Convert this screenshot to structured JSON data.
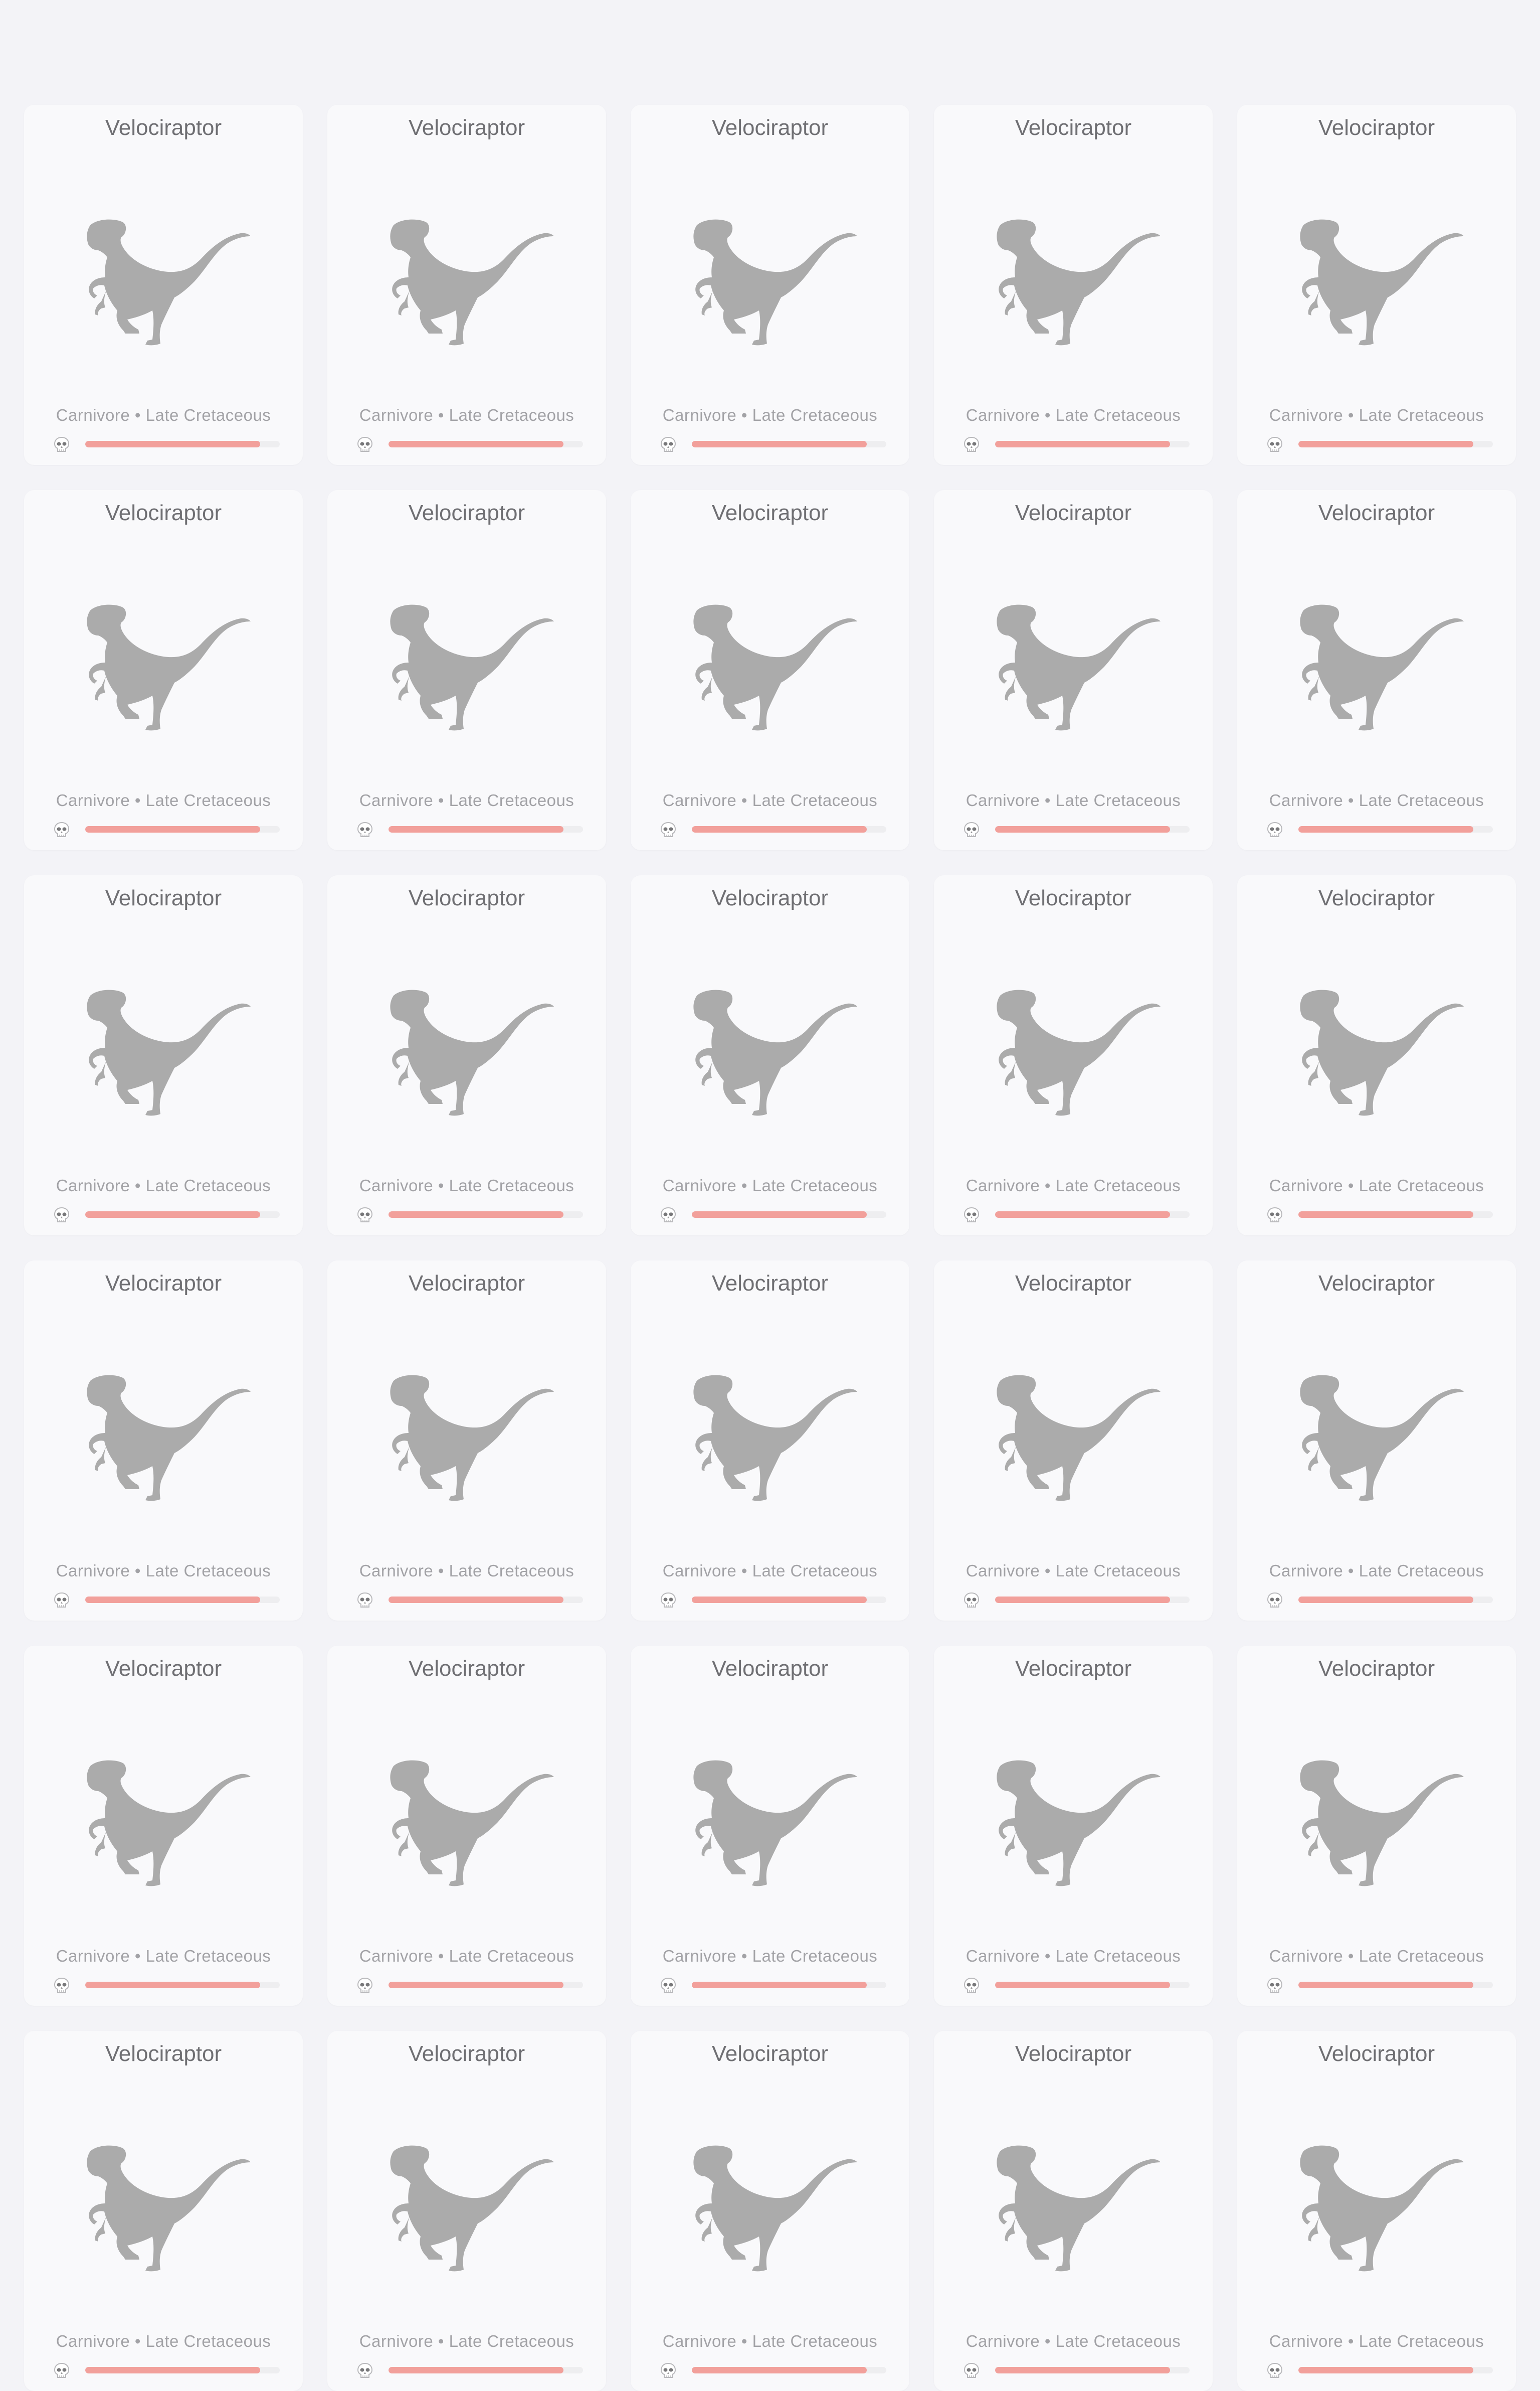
{
  "cards": [
    {
      "name": "Velociraptor",
      "diet": "Carnivore",
      "period": "Late Cretaceous",
      "danger": 0.9
    },
    {
      "name": "Velociraptor",
      "diet": "Carnivore",
      "period": "Late Cretaceous",
      "danger": 0.9
    },
    {
      "name": "Velociraptor",
      "diet": "Carnivore",
      "period": "Late Cretaceous",
      "danger": 0.9
    },
    {
      "name": "Velociraptor",
      "diet": "Carnivore",
      "period": "Late Cretaceous",
      "danger": 0.9
    },
    {
      "name": "Velociraptor",
      "diet": "Carnivore",
      "period": "Late Cretaceous",
      "danger": 0.9
    },
    {
      "name": "Velociraptor",
      "diet": "Carnivore",
      "period": "Late Cretaceous",
      "danger": 0.9
    },
    {
      "name": "Velociraptor",
      "diet": "Carnivore",
      "period": "Late Cretaceous",
      "danger": 0.9
    },
    {
      "name": "Velociraptor",
      "diet": "Carnivore",
      "period": "Late Cretaceous",
      "danger": 0.9
    },
    {
      "name": "Velociraptor",
      "diet": "Carnivore",
      "period": "Late Cretaceous",
      "danger": 0.9
    },
    {
      "name": "Velociraptor",
      "diet": "Carnivore",
      "period": "Late Cretaceous",
      "danger": 0.9
    },
    {
      "name": "Velociraptor",
      "diet": "Carnivore",
      "period": "Late Cretaceous",
      "danger": 0.9
    },
    {
      "name": "Velociraptor",
      "diet": "Carnivore",
      "period": "Late Cretaceous",
      "danger": 0.9
    },
    {
      "name": "Velociraptor",
      "diet": "Carnivore",
      "period": "Late Cretaceous",
      "danger": 0.9
    },
    {
      "name": "Velociraptor",
      "diet": "Carnivore",
      "period": "Late Cretaceous",
      "danger": 0.9
    },
    {
      "name": "Velociraptor",
      "diet": "Carnivore",
      "period": "Late Cretaceous",
      "danger": 0.9
    },
    {
      "name": "Velociraptor",
      "diet": "Carnivore",
      "period": "Late Cretaceous",
      "danger": 0.9
    },
    {
      "name": "Velociraptor",
      "diet": "Carnivore",
      "period": "Late Cretaceous",
      "danger": 0.9
    },
    {
      "name": "Velociraptor",
      "diet": "Carnivore",
      "period": "Late Cretaceous",
      "danger": 0.9
    },
    {
      "name": "Velociraptor",
      "diet": "Carnivore",
      "period": "Late Cretaceous",
      "danger": 0.9
    },
    {
      "name": "Velociraptor",
      "diet": "Carnivore",
      "period": "Late Cretaceous",
      "danger": 0.9
    },
    {
      "name": "Velociraptor",
      "diet": "Carnivore",
      "period": "Late Cretaceous",
      "danger": 0.9
    },
    {
      "name": "Velociraptor",
      "diet": "Carnivore",
      "period": "Late Cretaceous",
      "danger": 0.9
    },
    {
      "name": "Velociraptor",
      "diet": "Carnivore",
      "period": "Late Cretaceous",
      "danger": 0.9
    },
    {
      "name": "Velociraptor",
      "diet": "Carnivore",
      "period": "Late Cretaceous",
      "danger": 0.9
    },
    {
      "name": "Velociraptor",
      "diet": "Carnivore",
      "period": "Late Cretaceous",
      "danger": 0.9
    },
    {
      "name": "Velociraptor",
      "diet": "Carnivore",
      "period": "Late Cretaceous",
      "danger": 0.9
    },
    {
      "name": "Velociraptor",
      "diet": "Carnivore",
      "period": "Late Cretaceous",
      "danger": 0.9
    },
    {
      "name": "Velociraptor",
      "diet": "Carnivore",
      "period": "Late Cretaceous",
      "danger": 0.9
    },
    {
      "name": "Velociraptor",
      "diet": "Carnivore",
      "period": "Late Cretaceous",
      "danger": 0.9
    },
    {
      "name": "Velociraptor",
      "diet": "Carnivore",
      "period": "Late Cretaceous",
      "danger": 0.9
    }
  ],
  "separator": "•",
  "icons": {
    "image": "velociraptor-silhouette-icon",
    "danger": "skull-icon"
  },
  "colors": {
    "page_bg": "#f3f3f7",
    "card_bg": "#f9f9fb",
    "silhouette": "#ababab",
    "danger_bar": "#f2a09b",
    "bar_track": "#eeeef0"
  }
}
